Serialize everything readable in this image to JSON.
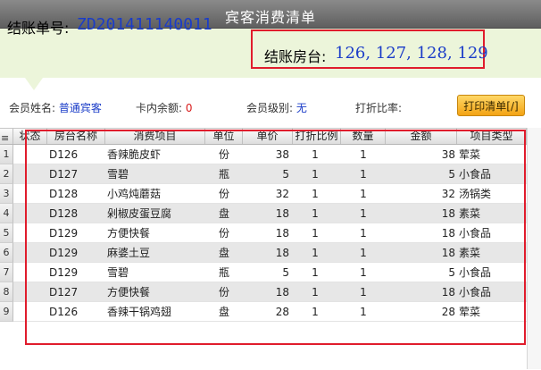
{
  "window": {
    "title": "宾客消费清单"
  },
  "header": {
    "bill_label": "结账单号:",
    "bill_number": "ZD201411140011",
    "rooms_label": "结账房台:",
    "rooms_value": "126, 127, 128, 129"
  },
  "info": {
    "member_name_label": "会员姓名:",
    "member_name_value": "普通宾客",
    "card_balance_label": "卡内余额:",
    "card_balance_value": "0",
    "member_level_label": "会员级别:",
    "member_level_value": "无",
    "discount_label": "打折比率:",
    "discount_value": ""
  },
  "toolbar": {
    "print_label": "打印清单[/]"
  },
  "table": {
    "columns": [
      "状态",
      "房台名称",
      "消费项目",
      "单位",
      "单价",
      "打折比例",
      "数量",
      "金额",
      "项目类型"
    ],
    "rows": [
      {
        "num": "1",
        "status": "",
        "room": "D126",
        "item": "香辣脆皮虾",
        "unit": "份",
        "price": "38",
        "discount": "1",
        "qty": "1",
        "amount": "38",
        "type": "荤菜"
      },
      {
        "num": "2",
        "status": "",
        "room": "D127",
        "item": "雪碧",
        "unit": "瓶",
        "price": "5",
        "discount": "1",
        "qty": "1",
        "amount": "5",
        "type": "小食品"
      },
      {
        "num": "3",
        "status": "",
        "room": "D128",
        "item": "小鸡炖蘑菇",
        "unit": "份",
        "price": "32",
        "discount": "1",
        "qty": "1",
        "amount": "32",
        "type": "汤锅类"
      },
      {
        "num": "4",
        "status": "",
        "room": "D128",
        "item": "剁椒皮蛋豆腐",
        "unit": "盘",
        "price": "18",
        "discount": "1",
        "qty": "1",
        "amount": "18",
        "type": "素菜"
      },
      {
        "num": "5",
        "status": "",
        "room": "D129",
        "item": "方便快餐",
        "unit": "份",
        "price": "18",
        "discount": "1",
        "qty": "1",
        "amount": "18",
        "type": "小食品"
      },
      {
        "num": "6",
        "status": "",
        "room": "D129",
        "item": "麻婆土豆",
        "unit": "盘",
        "price": "18",
        "discount": "1",
        "qty": "1",
        "amount": "18",
        "type": "素菜"
      },
      {
        "num": "7",
        "status": "",
        "room": "D129",
        "item": "雪碧",
        "unit": "瓶",
        "price": "5",
        "discount": "1",
        "qty": "1",
        "amount": "5",
        "type": "小食品"
      },
      {
        "num": "8",
        "status": "",
        "room": "D127",
        "item": "方便快餐",
        "unit": "份",
        "price": "18",
        "discount": "1",
        "qty": "1",
        "amount": "18",
        "type": "小食品"
      },
      {
        "num": "9",
        "status": "",
        "room": "D126",
        "item": "香辣干锅鸡翅",
        "unit": "盘",
        "price": "28",
        "discount": "1",
        "qty": "1",
        "amount": "28",
        "type": "荤菜"
      }
    ]
  },
  "colors": {
    "accent_blue": "#1a3cc8",
    "highlight_red": "#e01c2c",
    "button_orange": "#f3a314",
    "header_bg": "#ecf5da"
  }
}
